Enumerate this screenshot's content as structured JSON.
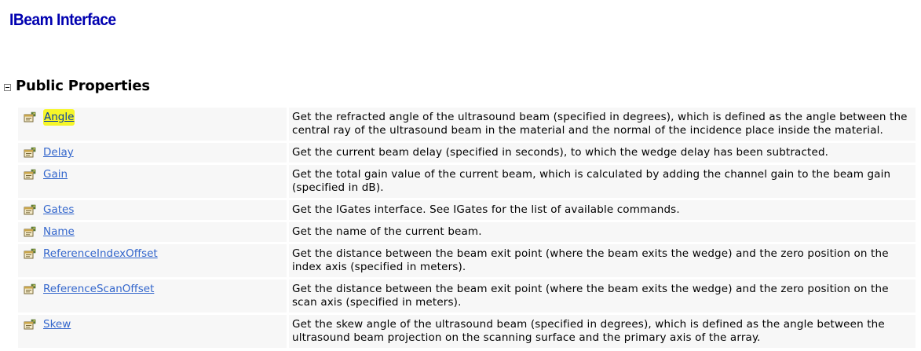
{
  "page": {
    "title": "IBeam Interface"
  },
  "section": {
    "title": "Public Properties",
    "collapse_icon": "collapse-minus-icon"
  },
  "property_icon": "property-icon",
  "highlight_color": "#f6f629",
  "link_color": "#3366cc",
  "title_color": "#0000b0",
  "properties": [
    {
      "name": "Angle",
      "description": "Get the refracted angle of the ultrasound beam (specified in degrees), which is defined as the angle between the central ray of the ultrasound beam in the material and the normal of the incidence place inside the material.",
      "highlighted": true
    },
    {
      "name": "Delay",
      "description": "Get the current beam delay (specified in seconds), to which the wedge delay has been subtracted."
    },
    {
      "name": "Gain",
      "description": "Get the total gain value of the current beam, which is calculated by adding the channel gain to the beam gain (specified in dB)."
    },
    {
      "name": "Gates",
      "description": "Get the IGates interface. See IGates for the list of available commands."
    },
    {
      "name": "Name",
      "description": "Get the name of the current beam."
    },
    {
      "name": "ReferenceIndexOffset",
      "description": "Get the distance between the beam exit point (where the beam exits the wedge) and the zero position on the index axis (specified in meters)."
    },
    {
      "name": "ReferenceScanOffset",
      "description": "Get the distance between the beam exit point (where the beam exits the wedge) and the zero position on the scan axis (specified in meters)."
    },
    {
      "name": "Skew",
      "description": "Get the skew angle of the ultrasound beam (specified in degrees), which is defined as the angle between the ultrasound beam projection on the scanning surface and the primary axis of the array."
    }
  ]
}
